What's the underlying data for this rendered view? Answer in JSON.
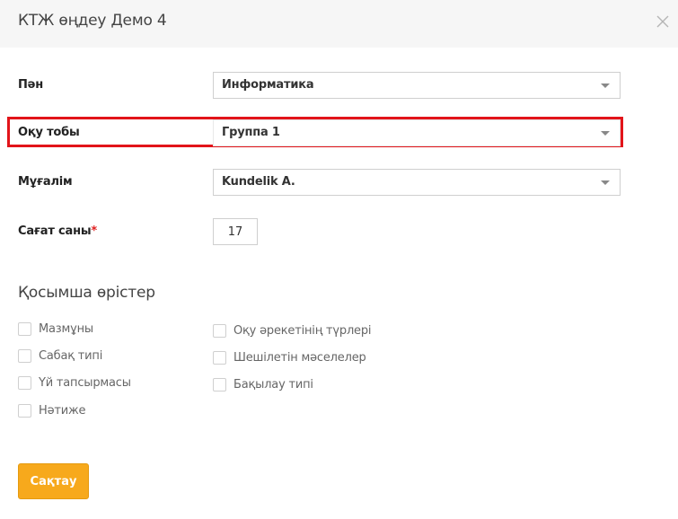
{
  "modal": {
    "title": "КТЖ өңдеу Демо 4"
  },
  "form": {
    "subject": {
      "label": "Пән",
      "value": "Информатика"
    },
    "group": {
      "label": "Оқу тобы",
      "value": "Группа 1"
    },
    "teacher": {
      "label": "Мұғалім",
      "value": "Kundelik A."
    },
    "hours": {
      "label": "Сағат саны",
      "required_mark": "*",
      "value": "17"
    }
  },
  "extra_fields": {
    "title": "Қосымша өрістер",
    "left_column": [
      {
        "label": "Мазмұны",
        "checked": false
      },
      {
        "label": "Сабақ типі",
        "checked": false
      },
      {
        "label": "Үй тапсырмасы",
        "checked": false
      },
      {
        "label": "Нәтиже",
        "checked": false
      }
    ],
    "right_column": [
      {
        "label": "Оқу әрекетінің түрлері",
        "checked": false
      },
      {
        "label": "Шешілетін мәселелер",
        "checked": false
      },
      {
        "label": "Бақылау типі",
        "checked": false
      }
    ]
  },
  "footer": {
    "save_label": "Сақтау"
  },
  "colors": {
    "accent": "#f7a91c",
    "highlight": "#e2141a",
    "header_bg": "#f6f6f6"
  }
}
